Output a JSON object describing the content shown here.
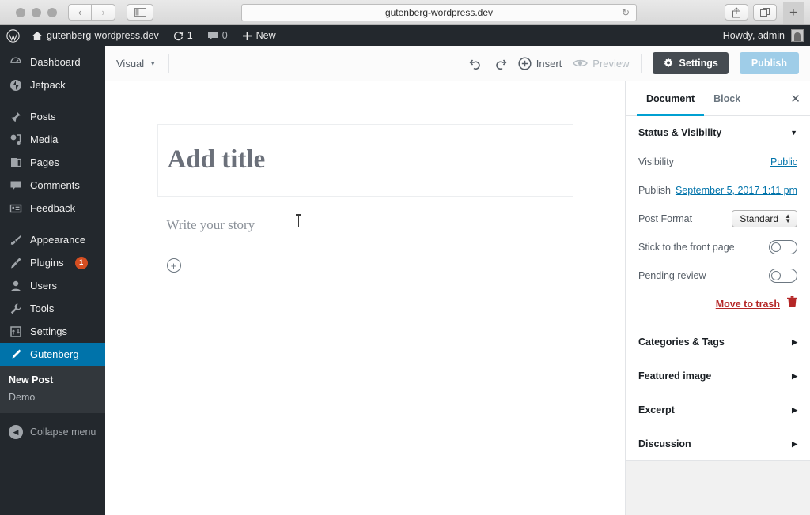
{
  "browser": {
    "url": "gutenberg-wordpress.dev",
    "reload_icon": "reload-icon",
    "back_icon": "‹",
    "forward_icon": "›",
    "new_tab_label": "+"
  },
  "adminbar": {
    "logo": "wordpress-logo",
    "site_name": "gutenberg-wordpress.dev",
    "updates_count": "1",
    "comments_count": "0",
    "new_label": "New",
    "howdy": "Howdy, admin"
  },
  "adminmenu": {
    "items": [
      {
        "label": "Dashboard",
        "icon": "dashboard-icon"
      },
      {
        "label": "Jetpack",
        "icon": "jetpack-icon"
      },
      {
        "label": "Posts",
        "icon": "pin-icon"
      },
      {
        "label": "Media",
        "icon": "media-icon"
      },
      {
        "label": "Pages",
        "icon": "pages-icon"
      },
      {
        "label": "Comments",
        "icon": "comment-icon"
      },
      {
        "label": "Feedback",
        "icon": "feedback-icon"
      },
      {
        "label": "Appearance",
        "icon": "brush-icon"
      },
      {
        "label": "Plugins",
        "icon": "plug-icon",
        "badge": "1"
      },
      {
        "label": "Users",
        "icon": "user-icon"
      },
      {
        "label": "Tools",
        "icon": "tools-icon"
      },
      {
        "label": "Settings",
        "icon": "settings-icon"
      },
      {
        "label": "Gutenberg",
        "icon": "pencil-icon"
      }
    ],
    "submenu": [
      {
        "label": "New Post"
      },
      {
        "label": "Demo"
      }
    ],
    "collapse_label": "Collapse menu"
  },
  "toolbar": {
    "mode_label": "Visual",
    "undo_icon": "undo-icon",
    "redo_icon": "redo-icon",
    "insert_label": "Insert",
    "preview_label": "Preview",
    "settings_label": "Settings",
    "publish_label": "Publish"
  },
  "editor": {
    "title_placeholder": "Add title",
    "body_placeholder": "Write your story",
    "inserter_icon": "plus-circle-icon"
  },
  "settings": {
    "tabs": [
      {
        "label": "Document",
        "active": true
      },
      {
        "label": "Block",
        "active": false
      }
    ],
    "close_icon": "close-icon",
    "status_panel": {
      "title": "Status & Visibility",
      "visibility_label": "Visibility",
      "visibility_value": "Public",
      "publish_label": "Publish",
      "publish_value": "September 5, 2017 1:11 pm",
      "post_format_label": "Post Format",
      "post_format_value": "Standard",
      "sticky_label": "Stick to the front page",
      "pending_label": "Pending review",
      "trash_label": "Move to trash",
      "trash_icon": "trash-icon"
    },
    "panels": [
      {
        "title": "Categories & Tags"
      },
      {
        "title": "Featured image"
      },
      {
        "title": "Excerpt"
      },
      {
        "title": "Discussion"
      }
    ]
  },
  "colors": {
    "accent_blue": "#0073aa",
    "tab_underline": "#00a0d2",
    "admin_dark": "#23282d",
    "submenu_dark": "#32373c",
    "badge_orange": "#d54e21",
    "publish_disabled": "#9fcde8",
    "settings_btn": "#454b51",
    "danger_red": "#b52727"
  }
}
